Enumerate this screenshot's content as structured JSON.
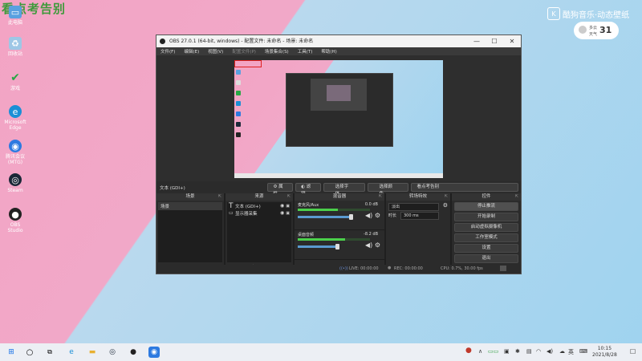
{
  "overlay_title": "看点考告别",
  "desktop_icons": [
    {
      "label": "此电脑",
      "color": "#5aa0e0",
      "glyph": "▭"
    },
    {
      "label": "回收站",
      "color": "#9ec7e6",
      "glyph": "♻"
    },
    {
      "label": "游戏",
      "color": "#28a745",
      "glyph": "✔"
    },
    {
      "label": "Microsoft Edge",
      "color": "#1a8fd6",
      "glyph": "e"
    },
    {
      "label": "腾讯会议(MTG)",
      "color": "#2d7ae0",
      "glyph": "◉"
    },
    {
      "label": "Steam",
      "color": "#1b2838",
      "glyph": "◎"
    },
    {
      "label": "OBS Studio",
      "color": "#222222",
      "glyph": "●"
    }
  ],
  "watermark": "酷狗音乐·动态壁纸",
  "weather": {
    "line1": "多云",
    "line2": "天气",
    "temp": "31"
  },
  "obs": {
    "title": "OBS 27.0.1 (64-bit, windows) - 配置文件: 未命名 - 场景: 未命名",
    "window_controls": [
      "—",
      "☐",
      "✕"
    ],
    "menu": [
      "文件(F)",
      "编辑(E)",
      "视图(V)",
      "配置文件(P)",
      "场景集合(S)",
      "工具(T)",
      "帮助(H)"
    ],
    "source_bar": {
      "current_label": "文本 (GDI+)",
      "properties": "属性",
      "filters": "滤镜",
      "font": "选择字体",
      "color": "选择颜色",
      "text_preview": "看点考告别"
    },
    "docks": {
      "scenes": {
        "title": "场景",
        "items": [
          "场景"
        ]
      },
      "sources": {
        "title": "来源",
        "items": [
          {
            "name": "文本 (GDI+)",
            "glyph": "T"
          },
          {
            "name": "显示器采集",
            "glyph": "▭"
          }
        ]
      },
      "mixer": {
        "title": "混音器",
        "channels": [
          {
            "name": "麦克风/Aux",
            "db": "0.0 dB",
            "level": 0.55,
            "volume": 0.8
          },
          {
            "name": "桌面音频",
            "db": "-8.2 dB",
            "level": 0.65,
            "volume": 0.6
          }
        ]
      },
      "transitions": {
        "title": "转场特效",
        "type": "淡出",
        "duration_label": "时长",
        "duration": "300 ms"
      },
      "controls": {
        "title": "控件",
        "buttons": [
          "停止推流",
          "开始录制",
          "启动虚拟摄像机",
          "工作室模式",
          "设置",
          "退出"
        ]
      }
    },
    "status": {
      "live": "LIVE: 00:00:00",
      "rec": "REC: 00:00:00",
      "cpu": "CPU: 0.7%, 30.00 fps"
    }
  },
  "taskbar": {
    "time": "10:15",
    "date": "2021/8/28",
    "lang": "英"
  }
}
